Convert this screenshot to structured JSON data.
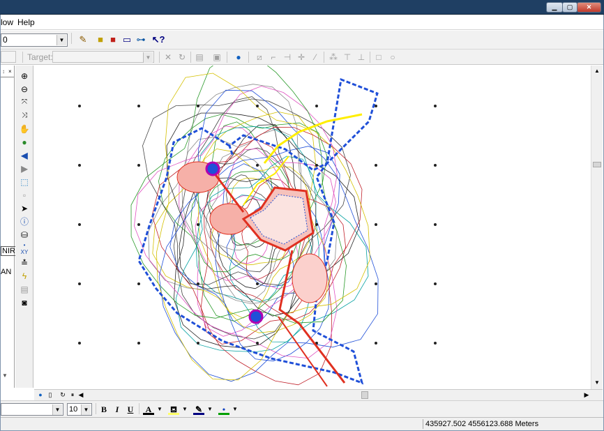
{
  "menu": {
    "window_partial": "low",
    "help": "Help"
  },
  "toolbar": {
    "scale_value": "0",
    "target_label": "Target:",
    "target_value": ""
  },
  "toc": {
    "layer_nir": "NIR",
    "layer_an": "AN"
  },
  "drawing": {
    "font_name": "",
    "font_size": "10",
    "bold": "B",
    "italic": "I",
    "underline": "U",
    "text_color_glyph": "A",
    "text_color": "#000000",
    "fill_color": "#ffff66",
    "line_color": "#000080",
    "marker_color": "#00a000"
  },
  "map": {
    "boundary_color": "#1f4fd8",
    "facility_color": "#e03020",
    "road_color": "#e03020"
  },
  "status": {
    "coordinates": "435927.502  4556123.688 Meters"
  },
  "icons": [
    "pencil-icon",
    "layers-icon",
    "toolbox-icon",
    "window-icon",
    "model-icon",
    "whats-this-icon",
    "zoom-in-icon",
    "zoom-out-icon",
    "fixed-zoom-in-icon",
    "fixed-zoom-out-icon",
    "pan-icon",
    "full-extent-icon",
    "back-icon",
    "forward-icon",
    "select-features-icon",
    "clear-selection-icon",
    "select-elements-icon",
    "identify-icon",
    "find-icon",
    "go-to-xy-icon",
    "measure-icon",
    "hyperlink-icon",
    "html-popup-icon",
    "time-slider-icon"
  ]
}
